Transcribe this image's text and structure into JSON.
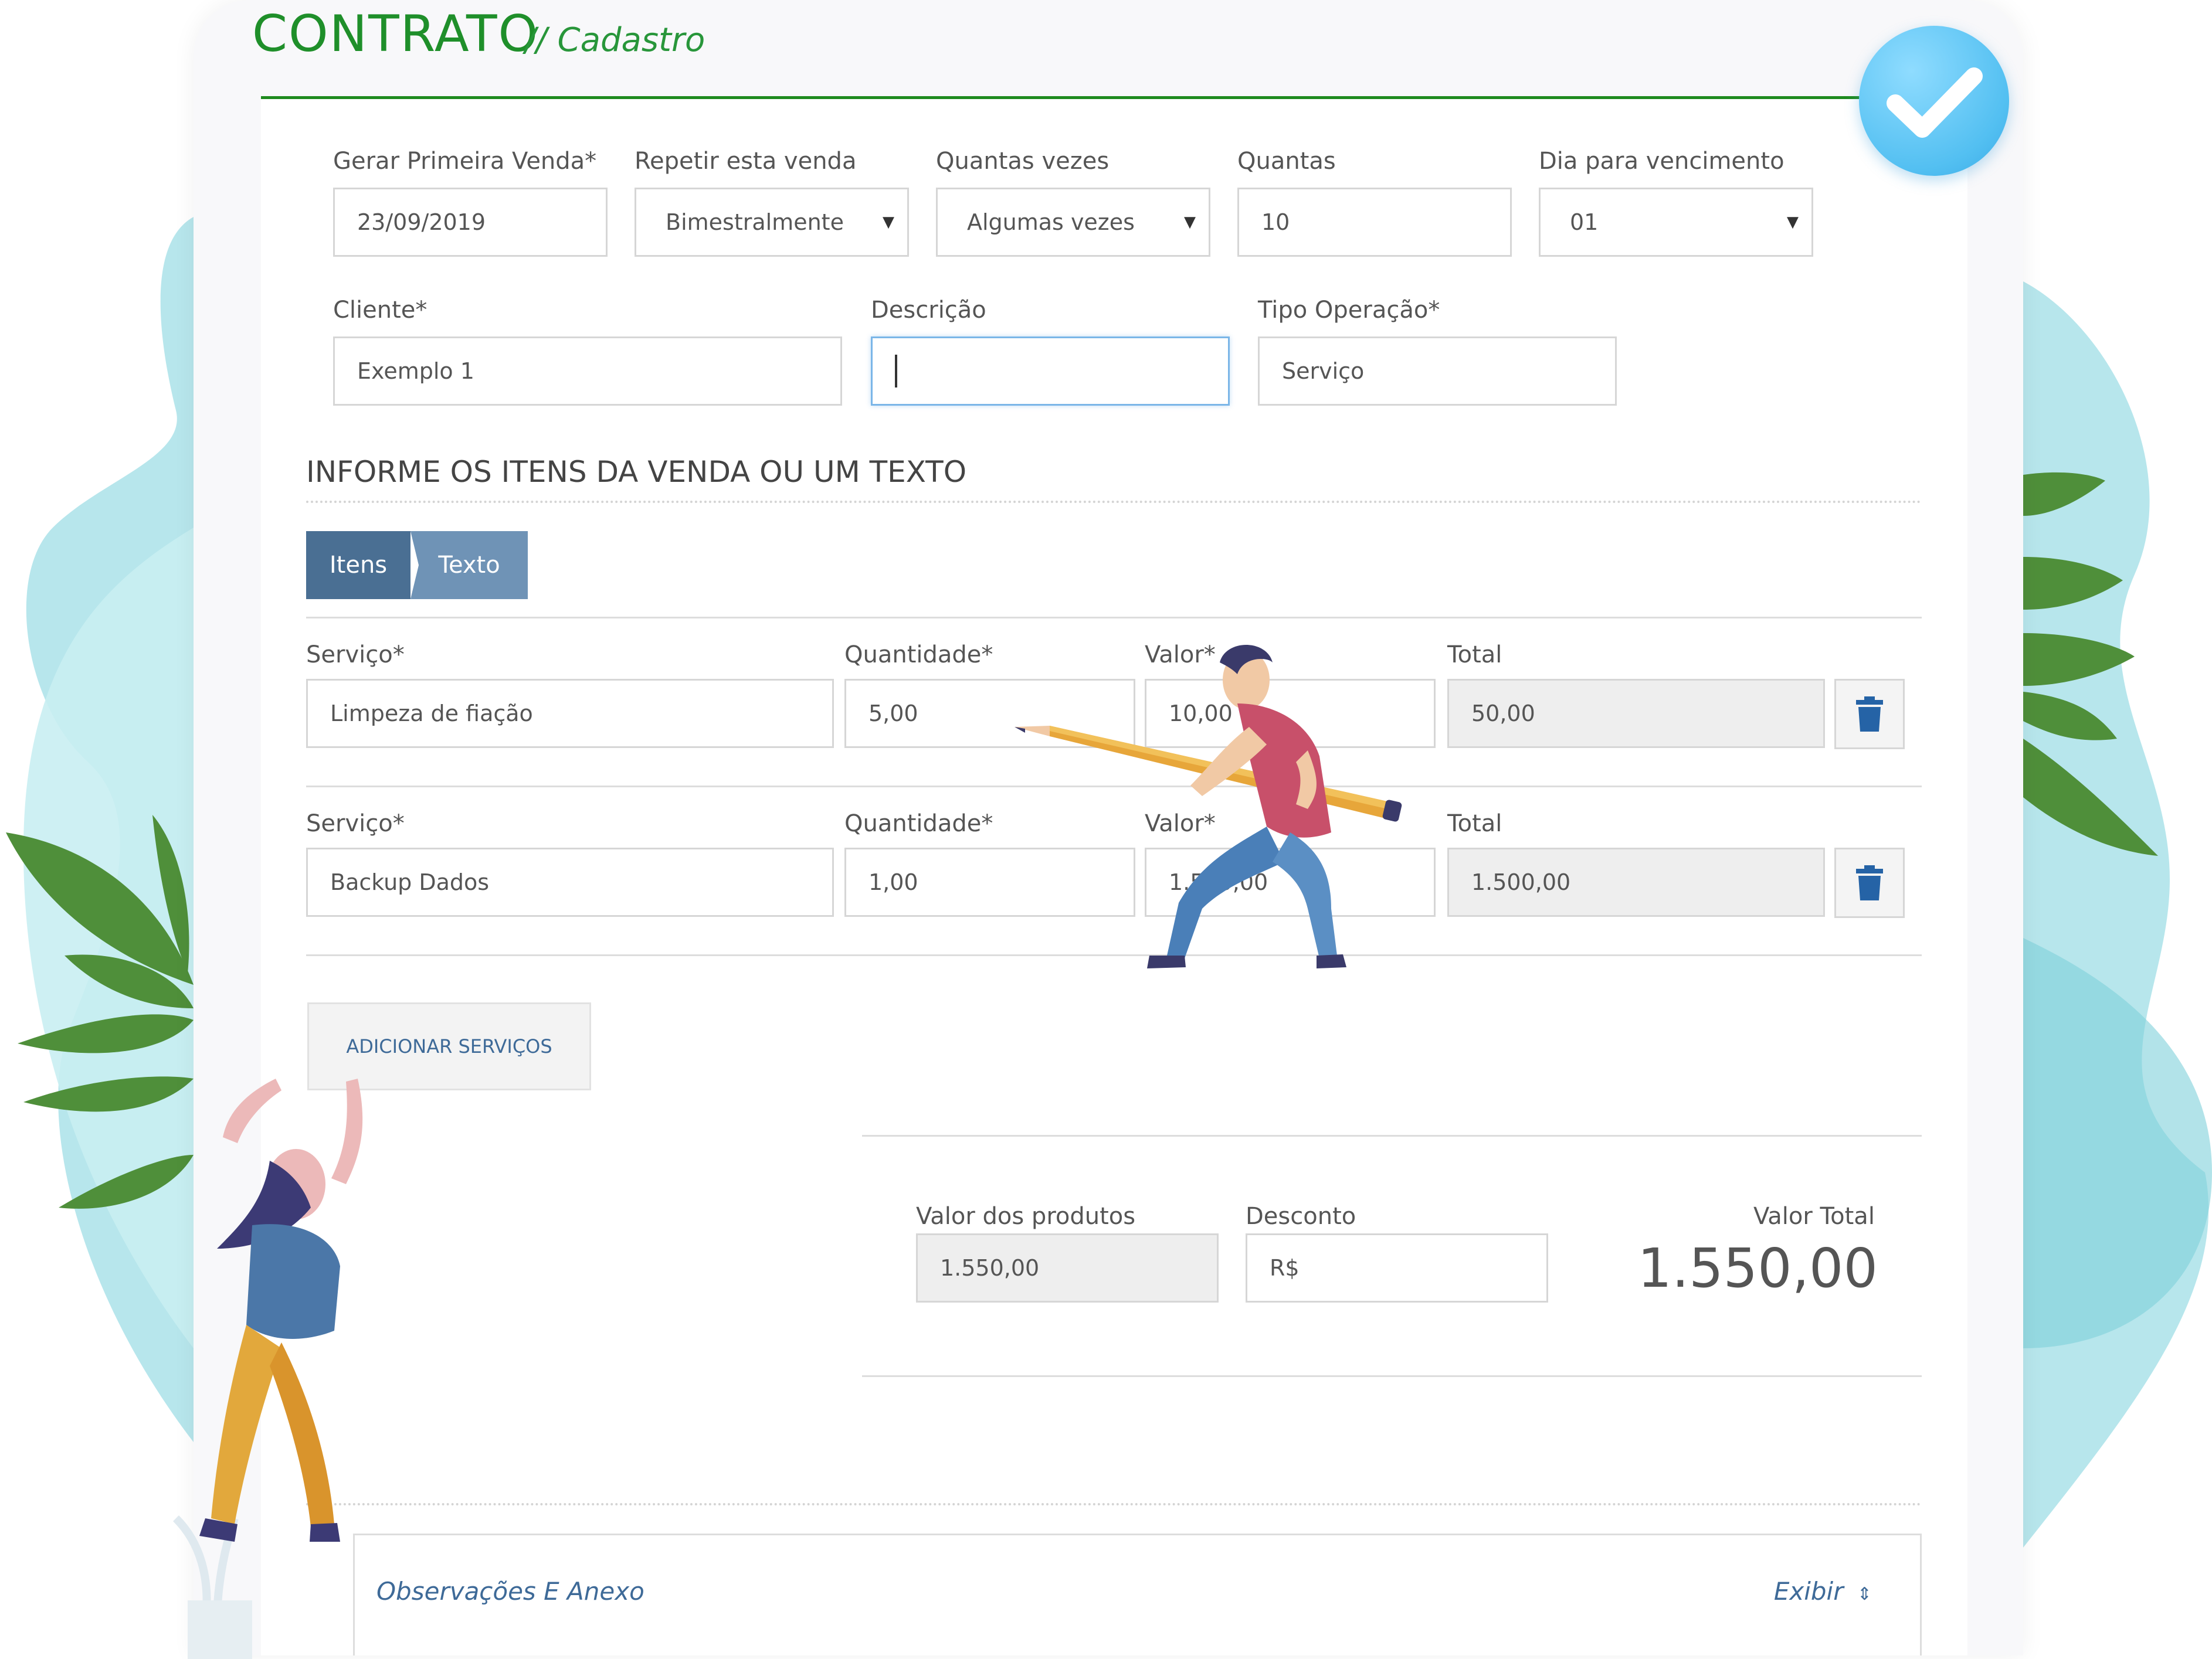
{
  "header": {
    "title": "CONTRATO",
    "subtitle": "// Cadastro"
  },
  "row1": {
    "first_sale": {
      "label": "Gerar Primeira Venda*",
      "value": "23/09/2019"
    },
    "repeat": {
      "label": "Repetir esta venda",
      "value": "Bimestralmente"
    },
    "how_many_times": {
      "label": "Quantas vezes",
      "value": "Algumas vezes"
    },
    "how_many": {
      "label": "Quantas",
      "value": "10"
    },
    "due_day": {
      "label": "Dia para vencimento",
      "value": "01"
    }
  },
  "row2": {
    "client": {
      "label": "Cliente*",
      "value": "Exemplo 1"
    },
    "description": {
      "label": "Descrição",
      "value": ""
    },
    "operation_type": {
      "label": "Tipo Operação*",
      "value": "Serviço"
    }
  },
  "items_section": {
    "title": "INFORME OS ITENS DA VENDA OU UM TEXTO",
    "tabs": [
      {
        "label": "Itens",
        "active": true
      },
      {
        "label": "Texto",
        "active": false
      }
    ],
    "columns": {
      "service": "Serviço*",
      "quantity": "Quantidade*",
      "value": "Valor*",
      "total": "Total"
    },
    "rows": [
      {
        "service": "Limpeza de fiação",
        "quantity": "5,00",
        "value": "10,00",
        "total": "50,00"
      },
      {
        "service": "Backup Dados",
        "quantity": "1,00",
        "value": "1.500,00",
        "total": "1.500,00"
      }
    ],
    "add_button": "ADICIONAR SERVIÇOS"
  },
  "summary": {
    "products_label": "Valor dos produtos",
    "products_value": "1.550,00",
    "discount_label": "Desconto",
    "discount_value": "R$",
    "total_label": "Valor Total",
    "total_value": "1.550,00"
  },
  "observations": {
    "label": "Observações E Anexo",
    "toggle": "Exibir"
  },
  "colors": {
    "title_green": "#1f8f2a",
    "tab_active": "#4a6f93",
    "tab_inactive": "#6f93b6",
    "link_blue": "#3e6a98",
    "trash_blue": "#2563a6",
    "check_blue": "#52bff1"
  },
  "icons": {
    "check": "check-icon",
    "trash": "trash-icon",
    "select": "caret-down-icon",
    "toggle": "chevron-updown-icon"
  }
}
